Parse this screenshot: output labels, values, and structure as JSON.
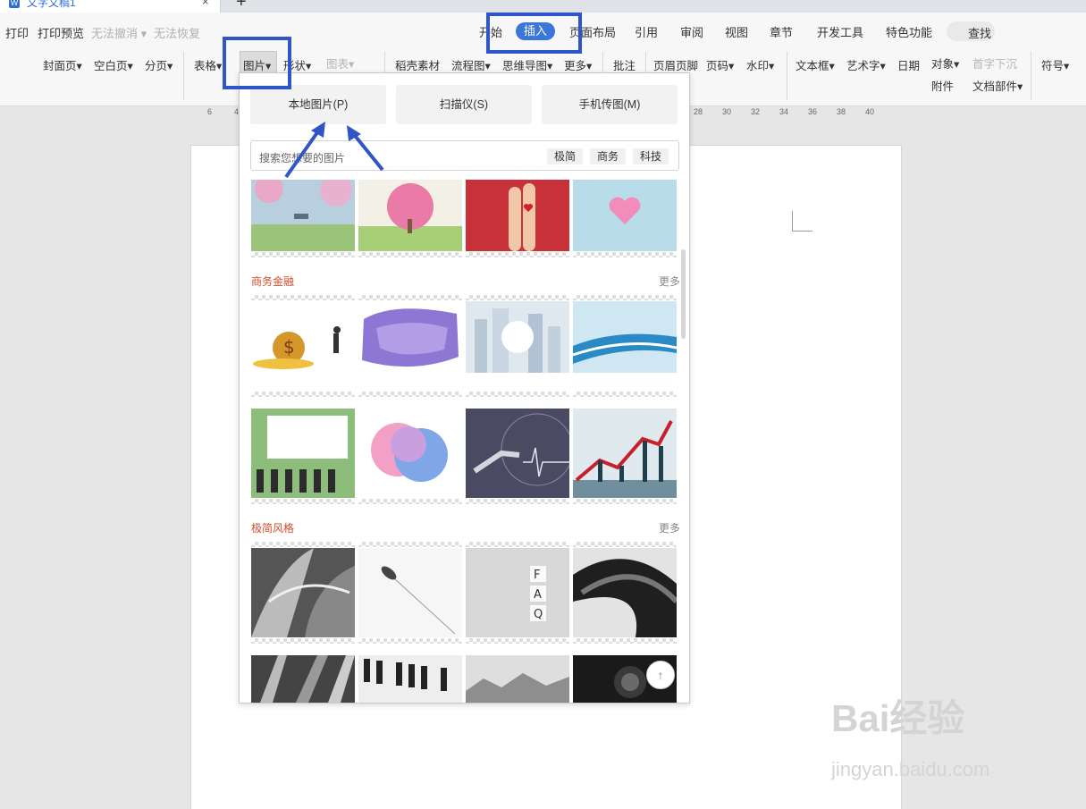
{
  "tab": {
    "doc_icon": "W",
    "title": "文字文稿1",
    "close": "×",
    "new_tab": "+"
  },
  "quick": {
    "print": "打印",
    "preview": "打印预览",
    "undo": "无法撤消",
    "redo": "无法恢复"
  },
  "menu": {
    "home": "开始",
    "insert": "插入",
    "layout": "页面布局",
    "references": "引用",
    "review": "审阅",
    "view": "视图",
    "chapter": "章节",
    "dev": "开发工具",
    "special": "特色功能",
    "search": "查找"
  },
  "toolbar": {
    "cover": "封面页",
    "blank": "空白页",
    "pagebreak": "分页",
    "table": "表格",
    "picture": "图片",
    "shape": "形状",
    "chart": "图表",
    "material": "稻壳素材",
    "flow": "流程图",
    "mindmap": "思维导图",
    "more": "更多",
    "comment": "批注",
    "header_footer": "页眉页脚",
    "page_num": "页码",
    "watermark": "水印",
    "textbox": "文本框",
    "wordart": "艺术字",
    "date": "日期",
    "object": "对象",
    "attachment": "附件",
    "dropcap": "首字下沉",
    "docpart": "文档部件",
    "symbol": "符号"
  },
  "ruler": [
    "6",
    "4",
    "28",
    "30",
    "32",
    "34",
    "36",
    "38",
    "40"
  ],
  "panel": {
    "local_picture": "本地图片(P)",
    "scanner": "扫描仪(S)",
    "phone_upload": "手机传图(M)",
    "search_placeholder": "搜索您想要的图片",
    "tags": [
      "极简",
      "商务",
      "科技"
    ],
    "sections": [
      {
        "title": "商务金融",
        "more": "更多"
      },
      {
        "title": "极简风格",
        "more": "更多"
      }
    ],
    "faq_letters": [
      "F",
      "A",
      "Q"
    ],
    "to_top": "↑"
  },
  "watermark": {
    "brand": "Bai经验",
    "url": "jingyan.baidu.com"
  },
  "colors": {
    "accent": "#3a77d9",
    "annotation": "#2f55c6",
    "section_title": "#d24b2d"
  }
}
